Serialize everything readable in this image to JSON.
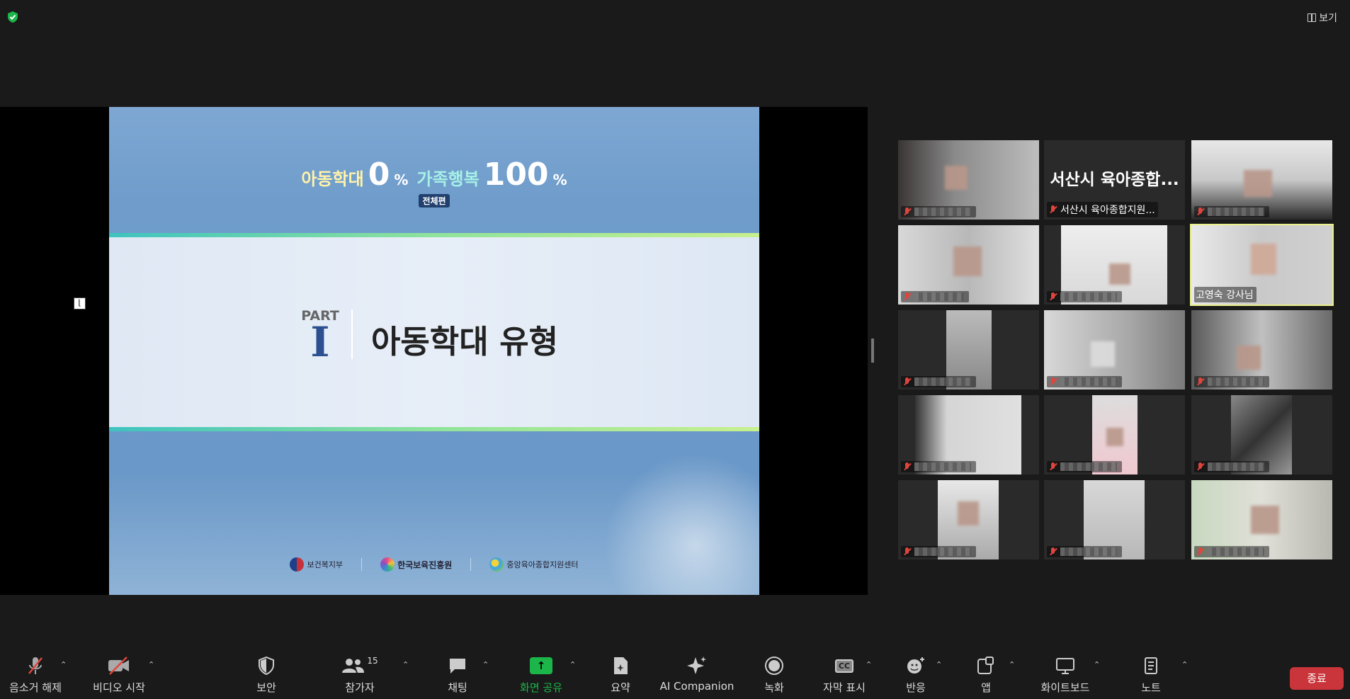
{
  "top": {
    "view_label": "보기"
  },
  "slide": {
    "slogan_a": "아동학대",
    "slogan_a_num": "0",
    "slogan_pct": "%",
    "slogan_b": "가족행복",
    "slogan_b_num": "100",
    "badge": "전체편",
    "part_label": "PART",
    "part_num": "I",
    "title": "아동학대 유형",
    "logos": [
      "보건복지부",
      "한국보육진흥원",
      "중앙육아종합지원센터"
    ]
  },
  "gallery": {
    "tiles": [
      {
        "name": "",
        "muted": true,
        "big": ""
      },
      {
        "name": "서산시 육아종합지원...",
        "muted": true,
        "big": "서산시 육아종합..."
      },
      {
        "name": "",
        "muted": true,
        "big": ""
      },
      {
        "name": "",
        "muted": true,
        "big": ""
      },
      {
        "name": "",
        "muted": true,
        "big": ""
      },
      {
        "name": "고영숙 강사님",
        "muted": false,
        "big": ""
      },
      {
        "name": "",
        "muted": true,
        "big": ""
      },
      {
        "name": "",
        "muted": true,
        "big": ""
      },
      {
        "name": "",
        "muted": true,
        "big": ""
      },
      {
        "name": "",
        "muted": true,
        "big": ""
      },
      {
        "name": "",
        "muted": true,
        "big": ""
      },
      {
        "name": "",
        "muted": true,
        "big": ""
      },
      {
        "name": "",
        "muted": true,
        "big": ""
      },
      {
        "name": "",
        "muted": true,
        "big": ""
      },
      {
        "name": "",
        "muted": true,
        "big": ""
      }
    ]
  },
  "toolbar": {
    "unmute": "음소거 해제",
    "video": "비디오 시작",
    "security": "보안",
    "participants": "참가자",
    "participants_count": "15",
    "chat": "채팅",
    "share": "화면 공유",
    "summary": "요약",
    "ai": "AI Companion",
    "record": "녹화",
    "captions": "자막 표시",
    "captions_icon": "CC",
    "reactions": "반응",
    "apps": "앱",
    "whiteboard": "화이트보드",
    "notes": "노트",
    "end": "종료"
  },
  "colors": {
    "end": "#c9353a",
    "share": "#1cb54a",
    "active_speaker": "#e9f08a"
  }
}
